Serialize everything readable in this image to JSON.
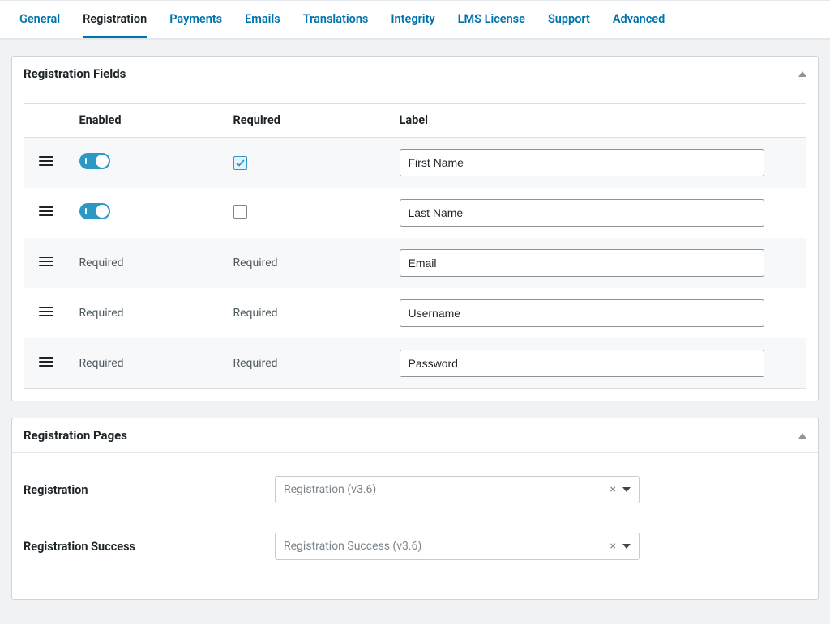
{
  "tabs": [
    {
      "label": "General",
      "active": false
    },
    {
      "label": "Registration",
      "active": true
    },
    {
      "label": "Payments",
      "active": false
    },
    {
      "label": "Emails",
      "active": false
    },
    {
      "label": "Translations",
      "active": false
    },
    {
      "label": "Integrity",
      "active": false
    },
    {
      "label": "LMS License",
      "active": false
    },
    {
      "label": "Support",
      "active": false
    },
    {
      "label": "Advanced",
      "active": false
    }
  ],
  "panel_fields": {
    "title": "Registration Fields",
    "headers": {
      "enabled": "Enabled",
      "required": "Required",
      "label": "Label"
    },
    "rows": [
      {
        "enabled_toggle": true,
        "required_checkbox": true,
        "required_text": "",
        "label": "First Name"
      },
      {
        "enabled_toggle": true,
        "required_checkbox": false,
        "required_text": "",
        "label": "Last Name"
      },
      {
        "enabled_fixed": "Required",
        "required_text": "Required",
        "label": "Email"
      },
      {
        "enabled_fixed": "Required",
        "required_text": "Required",
        "label": "Username"
      },
      {
        "enabled_fixed": "Required",
        "required_text": "Required",
        "label": "Password"
      }
    ]
  },
  "panel_pages": {
    "title": "Registration Pages",
    "rows": [
      {
        "label": "Registration",
        "value": "Registration (v3.6)"
      },
      {
        "label": "Registration Success",
        "value": "Registration Success (v3.6)"
      }
    ],
    "clear_symbol": "×"
  }
}
